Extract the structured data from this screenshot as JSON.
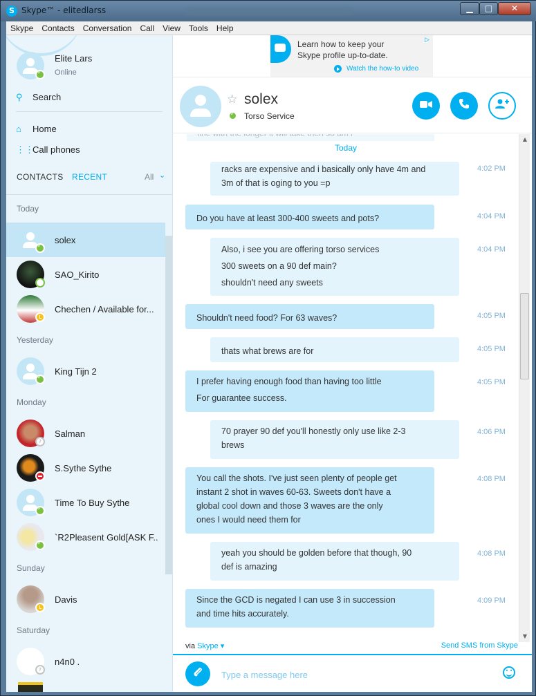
{
  "window": {
    "title": "Skype™ - elitedlarss",
    "min_label": "▁",
    "max_label": "□",
    "close_label": "✕"
  },
  "menu": [
    "Skype",
    "Contacts",
    "Conversation",
    "Call",
    "View",
    "Tools",
    "Help"
  ],
  "profile": {
    "name": "Elite Lars",
    "presence": "Online"
  },
  "sidebar": {
    "search_label": "Search",
    "home_label": "Home",
    "call_phones_label": "Call phones",
    "tab_contacts": "CONTACTS",
    "tab_recent": "RECENT",
    "filter_label": "All"
  },
  "groups": {
    "today": "Today",
    "yesterday": "Yesterday",
    "monday": "Monday",
    "sunday": "Sunday",
    "saturday": "Saturday"
  },
  "contacts": [
    {
      "name": "solex",
      "status": "online",
      "selected": true
    },
    {
      "name": "SAO_Kirito",
      "status": "offline"
    },
    {
      "name": "Chechen / Available for...",
      "status": "away"
    },
    {
      "name": "King Tijn 2",
      "status": "online"
    },
    {
      "name": "Salman",
      "status": "unknown"
    },
    {
      "name": "S.Sythe Sythe",
      "status": "dnd"
    },
    {
      "name": "Time To Buy Sythe",
      "status": "online"
    },
    {
      "name": "`R2Pleasent Gold[ASK F...",
      "status": "online"
    },
    {
      "name": "Davis",
      "status": "away"
    },
    {
      "name": "n4n0 .",
      "status": "unknown"
    }
  ],
  "ad": {
    "line1": "Learn how to keep your",
    "line2": "Skype profile up-to-date.",
    "cta": "Watch the how-to video",
    "adchoice": "▷"
  },
  "conversation": {
    "name": "solex",
    "mood": "Torso Service",
    "day_label": "Today",
    "ghost_text": "fine with the longer it will take then so am i"
  },
  "messages": [
    {
      "from": "me",
      "lines": [
        "racks are expensive and i basically only have 4m and",
        "3m of that is oging to you =p"
      ],
      "time": "4:02 PM"
    },
    {
      "from": "them",
      "lines": [
        "Do you have at least 300-400 sweets and pots?"
      ],
      "time": "4:04 PM"
    },
    {
      "from": "me",
      "lines": [
        "Also, i see you are offering torso services",
        "300 sweets on a 90 def main?",
        "shouldn't need any sweets"
      ],
      "time": "4:04 PM"
    },
    {
      "from": "them",
      "lines": [
        "Shouldn't need food? For 63 waves?"
      ],
      "time": "4:05 PM"
    },
    {
      "from": "me",
      "lines": [
        "thats what brews are for"
      ],
      "time": "4:05 PM"
    },
    {
      "from": "them",
      "lines": [
        "I prefer having enough food than having too little",
        "For guarantee success."
      ],
      "time": "4:05 PM"
    },
    {
      "from": "me",
      "lines": [
        "70 prayer 90 def you'll honestly only use like 2-3",
        "brews"
      ],
      "time": "4:06 PM"
    },
    {
      "from": "them",
      "lines": [
        "You call the shots. I've just seen plenty of people get",
        "instant 2  shot in waves 60-63. Sweets don't have a",
        "global cool down and those 3 waves are the only",
        "ones I would need them for"
      ],
      "time": "4:08 PM"
    },
    {
      "from": "me",
      "lines": [
        "yeah you should be golden before that though, 90",
        "def is amazing"
      ],
      "time": "4:08 PM"
    },
    {
      "from": "them",
      "lines": [
        "Since the GCD is negated I can use 3 in succession",
        "and time hits accurately."
      ],
      "time": "4:09 PM"
    }
  ],
  "footer": {
    "via_label": "via",
    "via_service": "Skype",
    "sms_label": "Send SMS from Skype"
  },
  "compose": {
    "placeholder": "Type a message here"
  },
  "colors": {
    "accent": "#00aff0",
    "bubble_them": "#c4e9fb",
    "bubble_me": "#e3f4fd",
    "selected_row": "#c4e5f5"
  }
}
